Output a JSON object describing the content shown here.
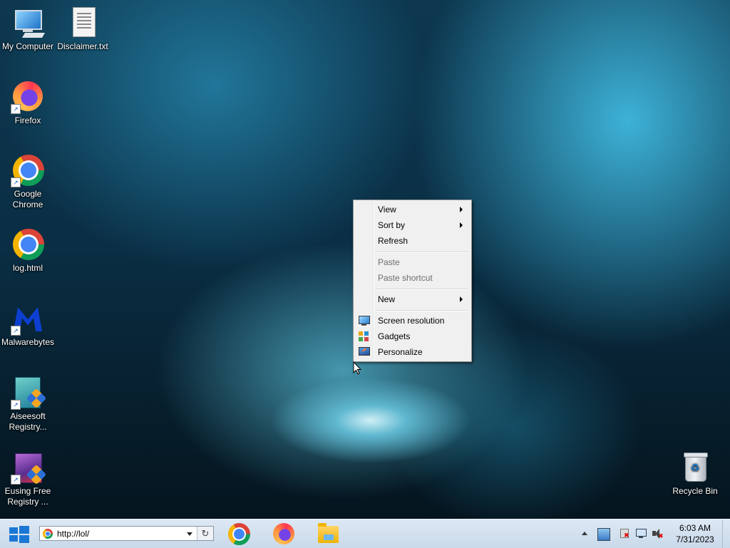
{
  "desktop": {
    "icons": [
      {
        "label": "My Computer",
        "icon": "computer-icon",
        "shortcut": false
      },
      {
        "label": "Disclaimer.txt",
        "icon": "text-document-icon",
        "shortcut": false
      },
      {
        "label": "Firefox",
        "icon": "firefox-icon",
        "shortcut": true
      },
      {
        "label": "Google Chrome",
        "icon": "chrome-icon",
        "shortcut": true
      },
      {
        "label": "log.html",
        "icon": "chrome-icon",
        "shortcut": false
      },
      {
        "label": "Malwarebytes",
        "icon": "malwarebytes-icon",
        "shortcut": true
      },
      {
        "label": "Aiseesoft Registry...",
        "icon": "aiseesoft-registry-icon",
        "shortcut": true
      },
      {
        "label": "Eusing Free Registry ...",
        "icon": "eusing-registry-icon",
        "shortcut": true
      },
      {
        "label": "Recycle Bin",
        "icon": "recycle-bin-icon",
        "shortcut": false
      }
    ]
  },
  "context_menu": {
    "items": [
      {
        "label": "View",
        "submenu": true,
        "enabled": true
      },
      {
        "label": "Sort by",
        "submenu": true,
        "enabled": true
      },
      {
        "label": "Refresh",
        "submenu": false,
        "enabled": true
      },
      {
        "label": "Paste",
        "submenu": false,
        "enabled": false
      },
      {
        "label": "Paste shortcut",
        "submenu": false,
        "enabled": false
      },
      {
        "label": "New",
        "submenu": true,
        "enabled": true
      },
      {
        "label": "Screen resolution",
        "icon": "screen-resolution-icon",
        "enabled": true
      },
      {
        "label": "Gadgets",
        "icon": "gadgets-icon",
        "enabled": true
      },
      {
        "label": "Personalize",
        "icon": "personalize-icon",
        "enabled": true
      }
    ]
  },
  "taskbar": {
    "start_icon": "windows-logo-icon",
    "address_bar": {
      "value": "http://lol/",
      "icon": "chrome-icon"
    },
    "pinned": [
      {
        "name": "Google Chrome",
        "icon": "chrome-icon"
      },
      {
        "name": "Firefox",
        "icon": "firefox-icon"
      },
      {
        "name": "File Explorer",
        "icon": "folder-icon"
      }
    ],
    "tray_icons": [
      "show-hidden-icons-arrow",
      "action-center-icon",
      "flag-error-icon",
      "network-icon",
      "volume-muted-icon"
    ],
    "clock": {
      "time": "6:03 AM",
      "date": "7/31/2023"
    }
  },
  "colors": {
    "taskbar": "#d6e3f1",
    "menu_bg": "#f0f0f0",
    "accent": "#1a78d4"
  }
}
